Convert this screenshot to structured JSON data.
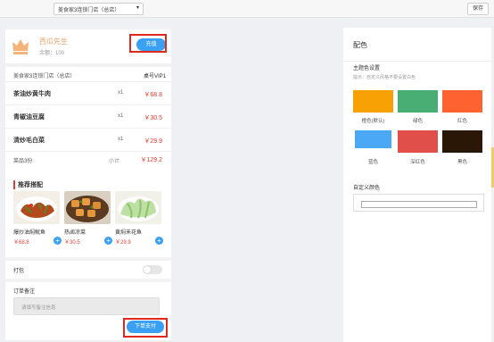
{
  "header": {
    "store_select": "美食家3连锁门店（总店）",
    "save_label": "保存"
  },
  "member": {
    "name": "西瓜先生",
    "balance": "余额：100",
    "recharge_label": "充值"
  },
  "order": {
    "store": "美食家3连锁门店（总店）",
    "table": "桌号VIP1",
    "dishes": [
      {
        "name": "茶油炒黄牛肉",
        "qty": "x1",
        "price": "￥68.8"
      },
      {
        "name": "青椒油豆腐",
        "qty": "x1",
        "price": "￥30.5"
      },
      {
        "name": "清炒毛白菜",
        "qty": "x1",
        "price": "￥29.9"
      }
    ],
    "count": "菜品3份",
    "subtotal_label": "小计",
    "subtotal": "￥129.2"
  },
  "recommend": {
    "title": "推荐搭配",
    "items": [
      {
        "name": "爆炒油焖鱿鱼",
        "price": "￥68.8"
      },
      {
        "name": "热卤凉菜",
        "price": "￥30.5"
      },
      {
        "name": "黄焖禾花鱼",
        "price": "￥29.9"
      }
    ]
  },
  "pack": {
    "label": "打包"
  },
  "note": {
    "label": "订单备注",
    "placeholder": "请填写备注信息",
    "pay_label": "下单支付"
  },
  "panel": {
    "title": "配色",
    "theme_title": "主题色设置",
    "theme_hint": "提示：自定义风格不要设置白色",
    "swatches": [
      {
        "label": "橙色(默认)",
        "color": "#f7a104"
      },
      {
        "label": "绿色",
        "color": "#49ae74"
      },
      {
        "label": "红色",
        "color": "#fd6230"
      },
      {
        "label": "蓝色",
        "color": "#4aa8f5"
      },
      {
        "label": "深红色",
        "color": "#e04f49"
      },
      {
        "label": "黑色",
        "color": "#2b1706"
      }
    ],
    "custom_title": "自定义颜色"
  },
  "colors": {
    "accent_blue": "#3aa0f4",
    "price_red": "#e63b2e",
    "highlight": "#e0281f"
  }
}
